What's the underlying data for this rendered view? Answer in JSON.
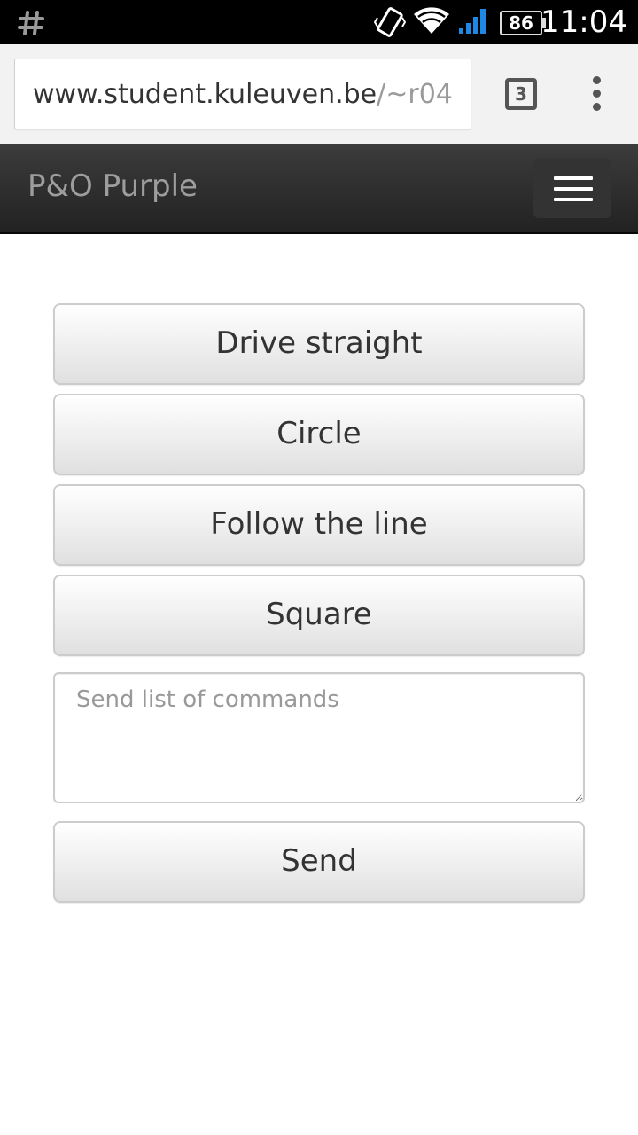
{
  "status_bar": {
    "icons": [
      "hash-notification-icon",
      "vibrate-icon",
      "wifi-icon",
      "cell-signal-icon",
      "battery-icon"
    ],
    "battery_level": "86",
    "time": "11:04"
  },
  "browser": {
    "url_host": "www.student.kuleuven.be",
    "url_path": "/~r04",
    "tab_count": "3",
    "menu_icon": "overflow-menu-icon"
  },
  "navbar": {
    "brand": "P&O Purple",
    "toggle_icon": "hamburger-menu-icon"
  },
  "main": {
    "buttons": [
      "Drive straight",
      "Circle",
      "Follow the line",
      "Square"
    ],
    "commands_placeholder": "Send list of commands",
    "commands_value": "",
    "send_label": "Send"
  },
  "colors": {
    "navbar_bg": "#222222",
    "brand_text": "#9d9d9d",
    "button_border": "#cccccc",
    "button_text": "#333333"
  }
}
